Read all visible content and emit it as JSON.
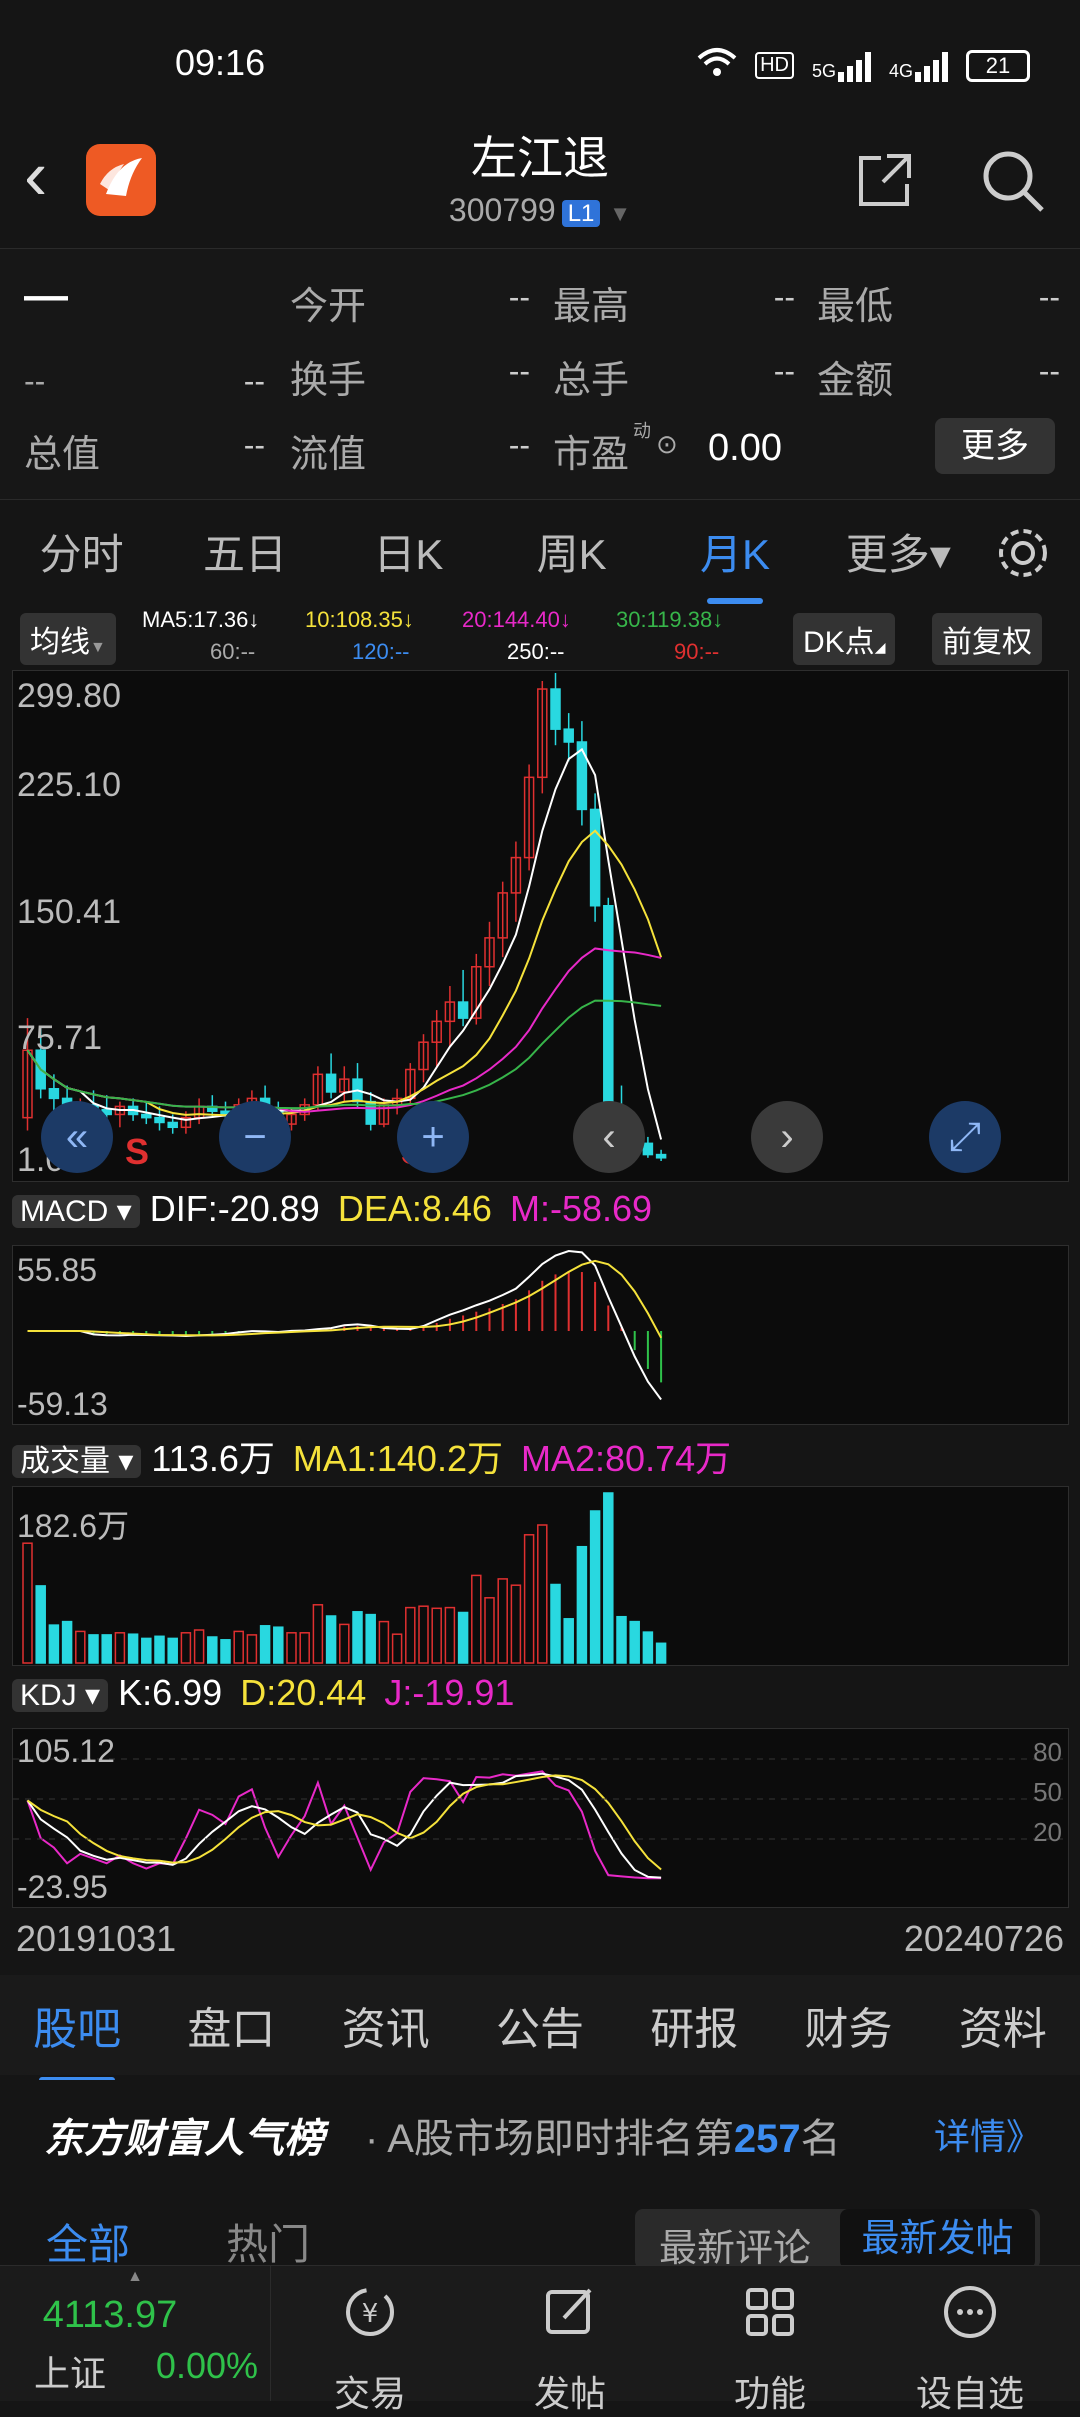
{
  "status": {
    "time": "09:16",
    "net1": "HD",
    "net2": "5G",
    "net3": "4G",
    "battery": "21"
  },
  "header": {
    "title": "左江退",
    "code": "300799",
    "level": "L1"
  },
  "quote": {
    "price": "—",
    "change": "--",
    "change2": "--",
    "open_label": "今开",
    "open": "--",
    "high_label": "最高",
    "high": "--",
    "low_label": "最低",
    "low": "--",
    "turnover_label": "换手",
    "turnover": "--",
    "volume_label": "总手",
    "volume": "--",
    "amount_label": "金额",
    "amount": "--",
    "mktcap_label": "总值",
    "mktcap": "--",
    "float_label": "流值",
    "float": "--",
    "pe_label": "市盈",
    "pe_sup": "动",
    "pe": "0.00",
    "more": "更多"
  },
  "tabs": [
    "分时",
    "五日",
    "日K",
    "周K",
    "月K",
    "更多▾"
  ],
  "ma": {
    "avg_btn": "均线",
    "ma5": "MA5:17.36↓",
    "ma10": "10:108.35↓",
    "ma20": "20:144.40↓",
    "ma30": "30:119.38↓",
    "ma60": "60:--",
    "ma120": "120:--",
    "ma250": "250:--",
    "ma90": "90:--",
    "dk_btn": "DK点",
    "fq_btn": "前复权",
    "colors": {
      "ma5": "#ffffff",
      "ma10": "#f5e23b",
      "ma20": "#e829c8",
      "ma30": "#37b54a",
      "ma60": "#bbbbbb",
      "ma120": "#3c8cf0"
    }
  },
  "chart_data": {
    "type": "candlestick",
    "yticks": [
      "299.80",
      "225.10",
      "150.41",
      "75.71",
      "1.01"
    ],
    "xlabels": [
      "20191031",
      "20240726"
    ],
    "ohlc": [
      [
        28,
        90,
        20,
        70
      ],
      [
        70,
        85,
        40,
        46
      ],
      [
        46,
        55,
        30,
        40
      ],
      [
        40,
        48,
        26,
        30
      ],
      [
        30,
        40,
        24,
        36
      ],
      [
        36,
        45,
        28,
        33
      ],
      [
        33,
        42,
        25,
        30
      ],
      [
        30,
        38,
        22,
        35
      ],
      [
        35,
        40,
        26,
        30
      ],
      [
        30,
        38,
        24,
        28
      ],
      [
        28,
        35,
        20,
        25
      ],
      [
        25,
        30,
        18,
        22
      ],
      [
        22,
        32,
        18,
        28
      ],
      [
        28,
        40,
        24,
        35
      ],
      [
        35,
        42,
        28,
        32
      ],
      [
        32,
        38,
        26,
        30
      ],
      [
        30,
        40,
        24,
        36
      ],
      [
        36,
        45,
        30,
        40
      ],
      [
        40,
        48,
        28,
        32
      ],
      [
        32,
        38,
        20,
        24
      ],
      [
        24,
        34,
        20,
        30
      ],
      [
        30,
        40,
        26,
        36
      ],
      [
        36,
        60,
        32,
        55
      ],
      [
        55,
        68,
        40,
        44
      ],
      [
        44,
        60,
        38,
        52
      ],
      [
        52,
        62,
        34,
        38
      ],
      [
        38,
        44,
        20,
        24
      ],
      [
        24,
        40,
        22,
        36
      ],
      [
        36,
        46,
        30,
        40
      ],
      [
        40,
        62,
        36,
        58
      ],
      [
        58,
        80,
        50,
        75
      ],
      [
        75,
        95,
        60,
        88
      ],
      [
        88,
        110,
        72,
        100
      ],
      [
        100,
        120,
        85,
        90
      ],
      [
        90,
        130,
        86,
        122
      ],
      [
        122,
        150,
        110,
        140
      ],
      [
        140,
        175,
        128,
        168
      ],
      [
        168,
        200,
        150,
        190
      ],
      [
        190,
        248,
        182,
        240
      ],
      [
        240,
        300,
        230,
        295
      ],
      [
        295,
        305,
        260,
        270
      ],
      [
        270,
        280,
        250,
        262
      ],
      [
        262,
        275,
        210,
        220
      ],
      [
        220,
        230,
        150,
        160
      ],
      [
        160,
        165,
        20,
        30
      ],
      [
        30,
        48,
        15,
        22
      ],
      [
        22,
        30,
        8,
        12
      ],
      [
        12,
        16,
        3,
        5
      ],
      [
        5,
        8,
        1,
        3
      ]
    ],
    "macd": {
      "DIF": "-20.89",
      "DEA": "8.46",
      "M": "-58.69",
      "top": "55.85",
      "bottom": "-59.13"
    },
    "volume": {
      "label": "成交量",
      "value": "113.6万",
      "MA1": "140.2万",
      "MA2": "80.74万",
      "top": "182.6万"
    },
    "kdj": {
      "K": "6.99",
      "D": "20.44",
      "J": "-19.91",
      "top": "105.12",
      "bottom": "-23.95",
      "levels": [
        "80",
        "50",
        "20"
      ]
    }
  },
  "bottom_tabs": [
    "股吧",
    "盘口",
    "资讯",
    "公告",
    "研报",
    "财务",
    "资料"
  ],
  "rank": {
    "brand": "东方财富人气榜",
    "text": "· A股市场即时排名第",
    "num": "257",
    "suffix": "名",
    "detail": "详情》"
  },
  "feed": {
    "tab_all": "全部",
    "tab_hot": "热门",
    "btn_comment": "最新评论",
    "btn_post": "最新发帖"
  },
  "nav": {
    "index_value": "4113.97",
    "index_name": "上证",
    "index_change": "0.00%",
    "trade": "交易",
    "post": "发帖",
    "func": "功能",
    "watch": "设自选"
  }
}
